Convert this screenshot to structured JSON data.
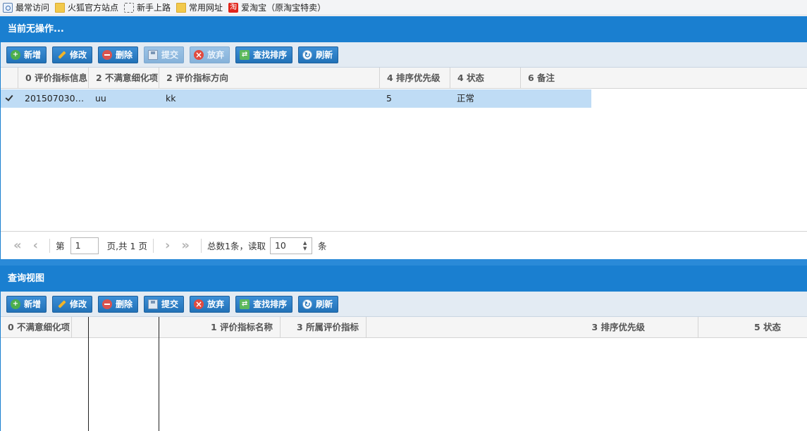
{
  "bookmarks": [
    {
      "label": "最常访问",
      "icon": "most-visited-icon"
    },
    {
      "label": "火狐官方站点",
      "icon": "folder-icon"
    },
    {
      "label": "新手上路",
      "icon": "dashed-box-icon"
    },
    {
      "label": "常用网址",
      "icon": "folder-icon"
    },
    {
      "label": "爱淘宝（原淘宝特卖）",
      "icon": "taobao-icon",
      "icon_text": "淘"
    }
  ],
  "top_panel": {
    "title": "当前无操作...",
    "toolbar": {
      "add": "新增",
      "edit": "修改",
      "delete": "删除",
      "submit": "提交",
      "discard": "放弃",
      "search_sort": "查找排序",
      "refresh": "刷新"
    },
    "columns": [
      "0 评价指标信息",
      "2 不满意细化项",
      "2 评价指标方向",
      "4 排序优先级",
      "4 状态",
      "6 备注"
    ],
    "rows": [
      {
        "checked": true,
        "c0": "201507030…",
        "c1": "uu",
        "c2": "kk",
        "c3": "5",
        "c4": "正常",
        "c5": ""
      }
    ],
    "pager": {
      "page_prefix": "第",
      "page_value": "1",
      "page_suffix": "页,共 1 页",
      "total_text": "总数1条，读取",
      "page_size": "10",
      "unit": "条"
    }
  },
  "bottom_panel": {
    "title": "查询视图",
    "toolbar": {
      "add": "新增",
      "edit": "修改",
      "delete": "删除",
      "submit": "提交",
      "discard": "放弃",
      "search_sort": "查找排序",
      "refresh": "刷新"
    },
    "columns": [
      "0 不满意细化项",
      "1 评价指标名称",
      "3 所属评价指标",
      "3 排序优先级",
      "5 状态"
    ]
  },
  "colors": {
    "accent": "#1a7fd0",
    "selected_row": "#bfdcf5",
    "toolbar_bg": "#e3ebf3"
  }
}
